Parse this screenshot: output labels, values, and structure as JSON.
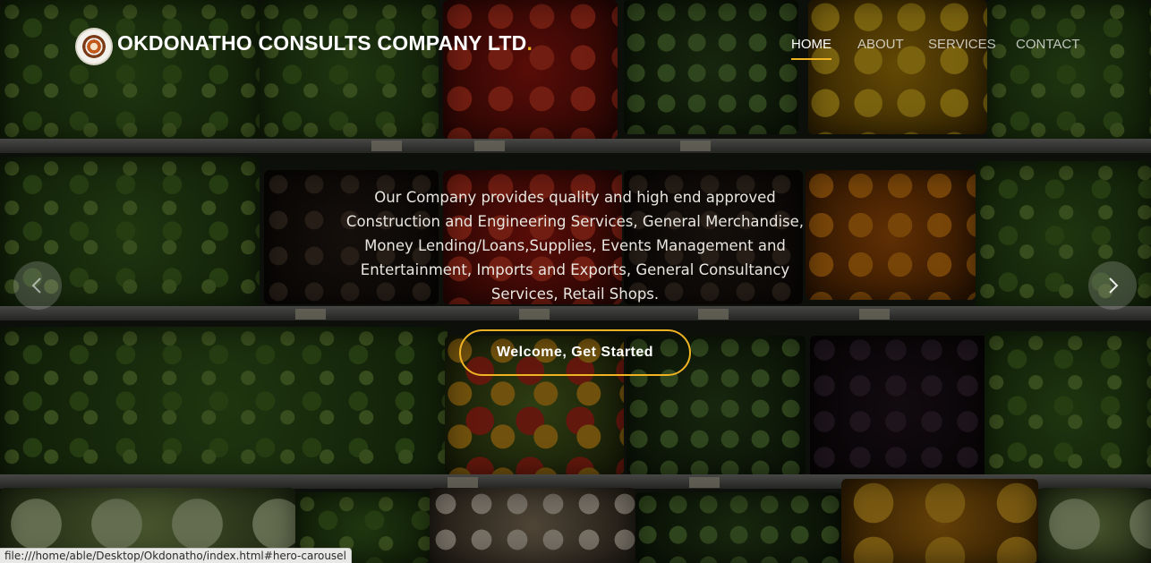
{
  "header": {
    "brand": "OKDONATHO CONSULTS COMPANY LTD",
    "brand_dot": ".",
    "logo_icon": "company-seal-logo",
    "nav": [
      {
        "label": "HOME",
        "active": true
      },
      {
        "label": "ABOUT",
        "active": false
      },
      {
        "label": "SERVICES",
        "active": false
      },
      {
        "label": "CONTACT",
        "active": false
      }
    ]
  },
  "hero": {
    "description": "Our Company provides quality and high end approved Construction and Engineering Services, General Merchandise, Money Lending/Loans,Supplies, Events Management and Entertainment, Imports and Exports, General Consultancy Services, Retail Shops.",
    "cta_label": "Welcome, Get Started",
    "prev_icon": "chevron-left-icon",
    "next_icon": "chevron-right-icon"
  },
  "status_bar": {
    "url": "file:///home/able/Desktop/Okdonatho/index.html#hero-carousel"
  },
  "colors": {
    "accent": "#f0b423",
    "text": "#ffffff",
    "overlay": "rgba(0,0,0,0.5)"
  }
}
